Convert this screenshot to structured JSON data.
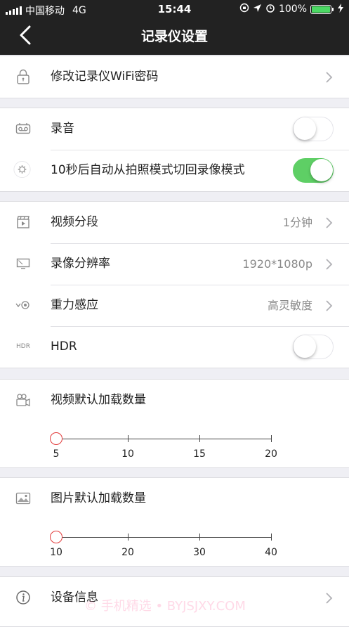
{
  "status_bar": {
    "carrier": "中国移动",
    "network": "4G",
    "time": "15:44",
    "battery": "100%"
  },
  "nav": {
    "title": "记录仪设置"
  },
  "wifi_password": {
    "label": "修改记录仪WiFi密码"
  },
  "audio": {
    "record_label": "录音",
    "record_on": false,
    "auto_switch_label": "10秒后自动从拍照模式切回录像模式",
    "auto_switch_on": true
  },
  "video": {
    "segment_label": "视频分段",
    "segment_value": "1分钟",
    "resolution_label": "录像分辨率",
    "resolution_value": "1920*1080p",
    "gsensor_label": "重力感应",
    "gsensor_value": "高灵敏度",
    "hdr_icon_text": "HDR",
    "hdr_label": "HDR",
    "hdr_on": false
  },
  "video_count": {
    "label": "视频默认加载数量",
    "ticks": [
      "5",
      "10",
      "15",
      "20"
    ],
    "selected_index": 0
  },
  "photo_count": {
    "label": "图片默认加载数量",
    "ticks": [
      "10",
      "20",
      "30",
      "40"
    ],
    "selected_index": 0
  },
  "device_info": {
    "label": "设备信息"
  },
  "watermark": "© 手机精选 • BYJSJXY.COM",
  "colors": {
    "toggle_on": "#5ecf65",
    "slider_thumb": "#e23b3b",
    "header_bg": "#222222"
  }
}
